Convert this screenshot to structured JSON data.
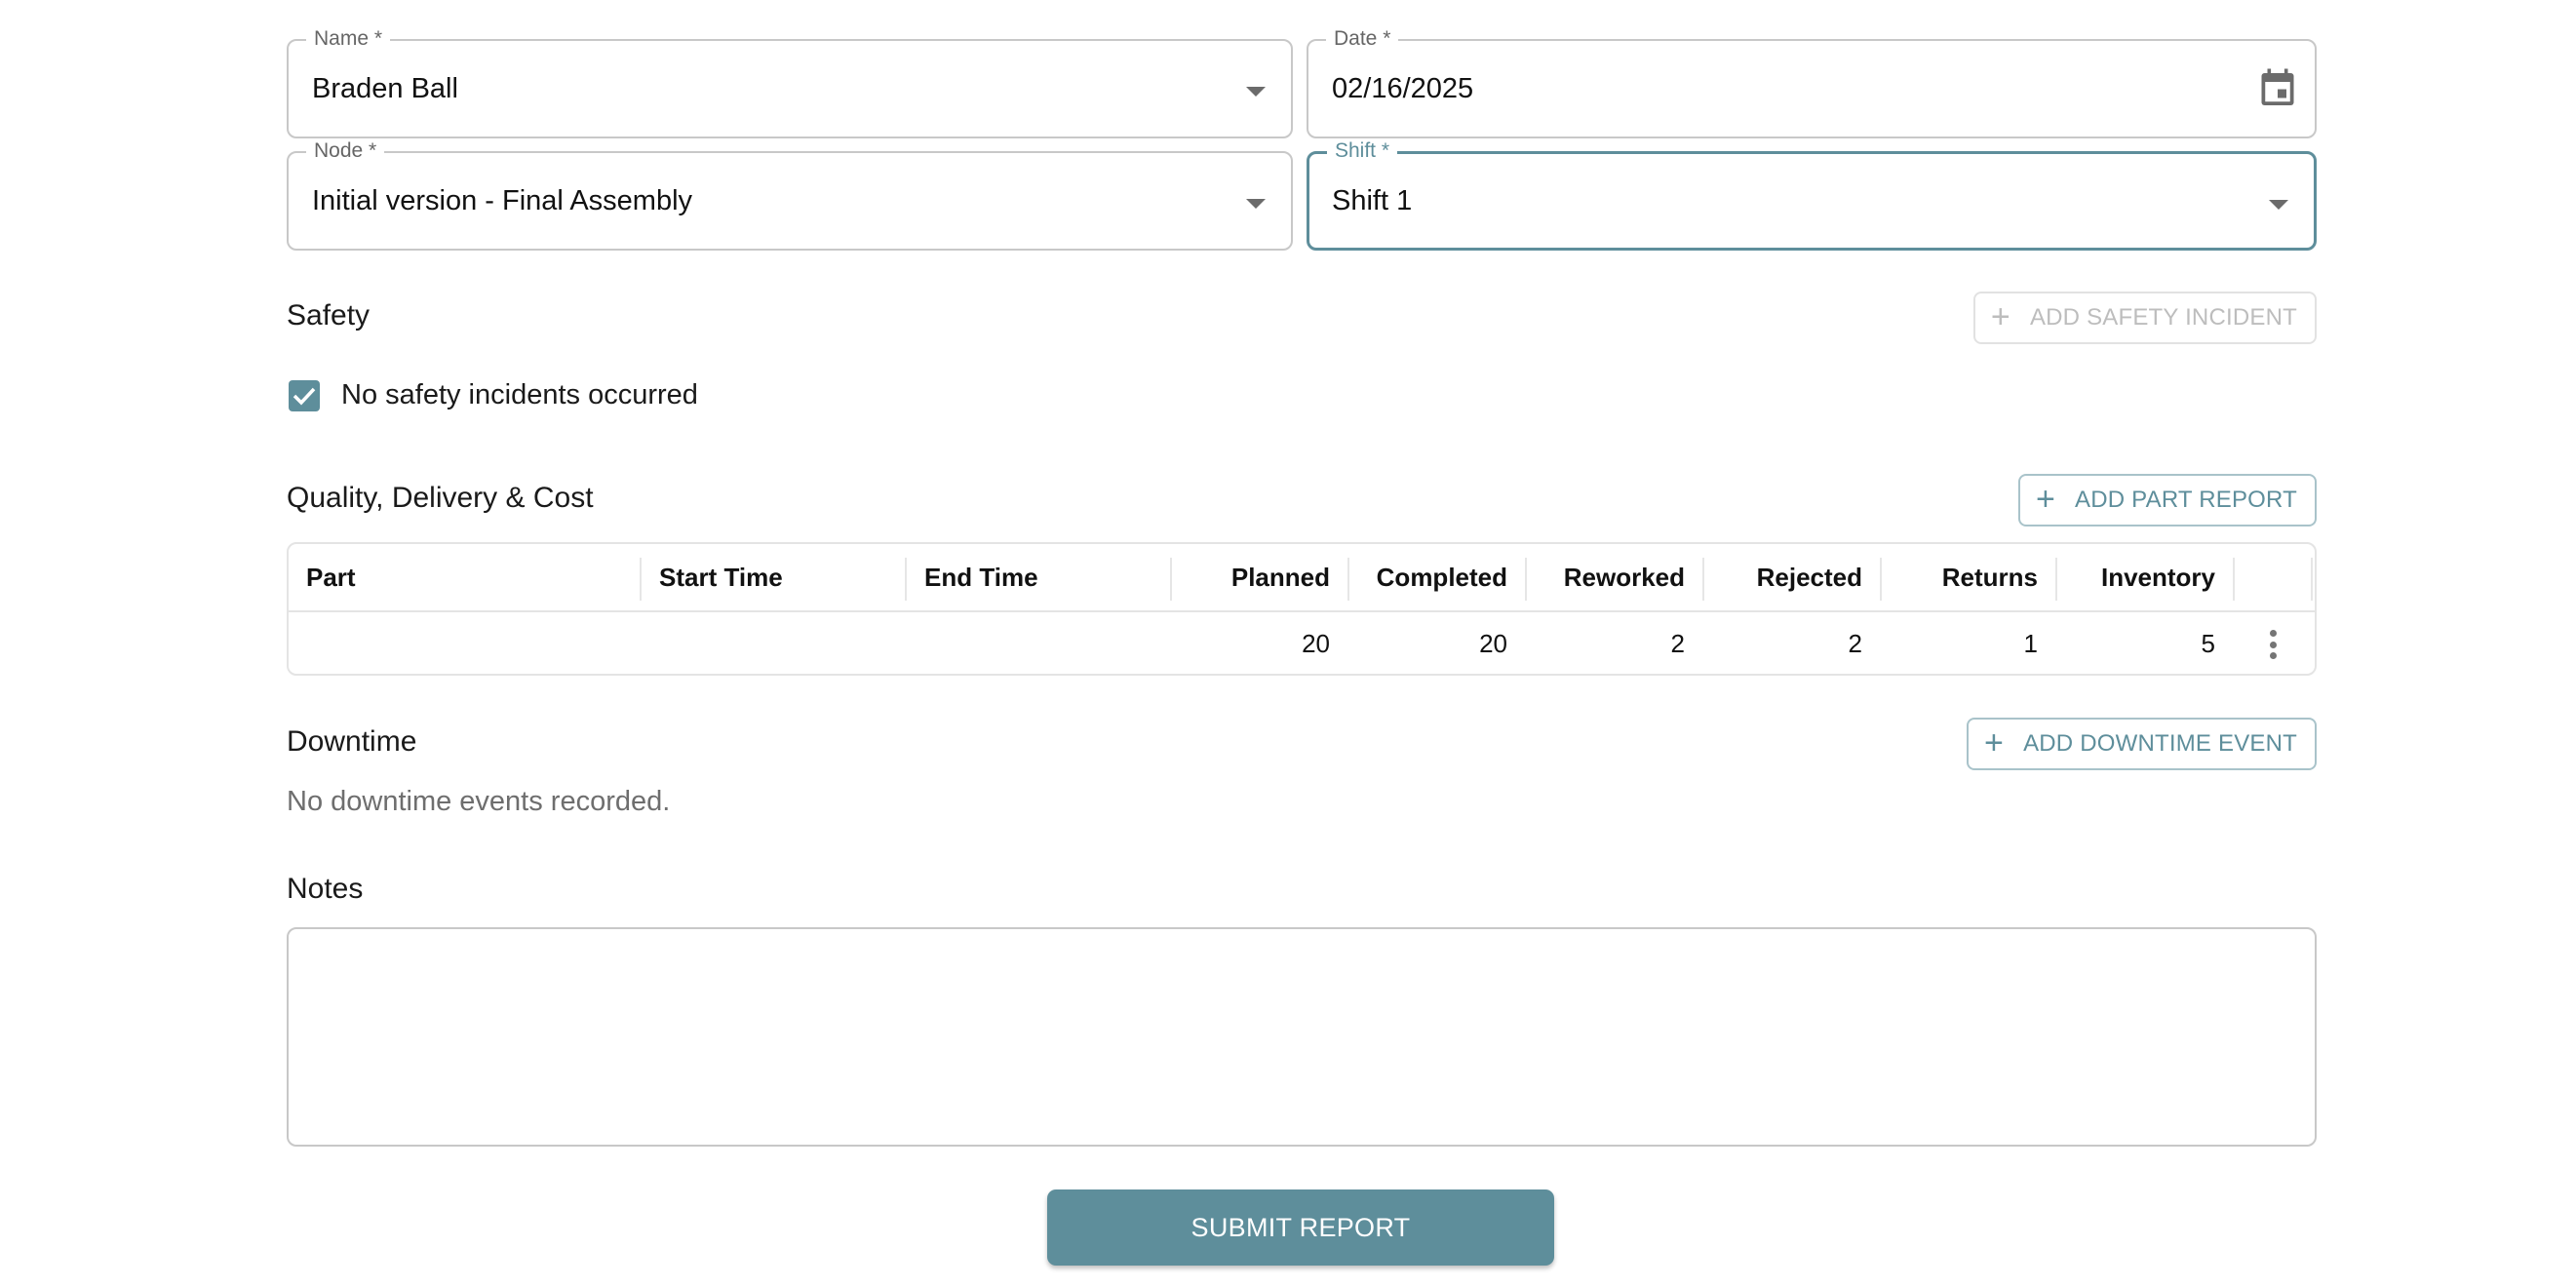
{
  "colors": {
    "accent": "#5e8e9b",
    "border": "#c8c8c8",
    "muted_text": "#6e6e6e",
    "disabled": "#bdbdbd"
  },
  "fields": {
    "name": {
      "label": "Name *",
      "value": "Braden Ball",
      "icon": "chevron-down-icon"
    },
    "date": {
      "label": "Date *",
      "value": "02/16/2025",
      "icon": "calendar-icon"
    },
    "node": {
      "label": "Node *",
      "value": "Initial version - Final Assembly",
      "icon": "chevron-down-icon"
    },
    "shift": {
      "label": "Shift *",
      "value": "Shift 1",
      "icon": "chevron-down-icon",
      "focused": true
    }
  },
  "safety": {
    "title": "Safety",
    "add_button": "ADD SAFETY INCIDENT",
    "add_button_disabled": true,
    "checkbox_label": "No safety incidents occurred",
    "checkbox_checked": true
  },
  "qdc": {
    "title": "Quality, Delivery & Cost",
    "add_button": "ADD PART REPORT",
    "columns": [
      "Part",
      "Start Time",
      "End Time",
      "Planned",
      "Completed",
      "Reworked",
      "Rejected",
      "Returns",
      "Inventory",
      ""
    ],
    "rows": [
      {
        "part": "",
        "start_time": "",
        "end_time": "",
        "planned": "20",
        "completed": "20",
        "reworked": "2",
        "rejected": "2",
        "returns": "1",
        "inventory": "5"
      }
    ]
  },
  "downtime": {
    "title": "Downtime",
    "add_button": "ADD DOWNTIME EVENT",
    "empty_text": "No downtime events recorded."
  },
  "notes": {
    "title": "Notes",
    "value": "",
    "placeholder": ""
  },
  "submit_label": "SUBMIT REPORT"
}
